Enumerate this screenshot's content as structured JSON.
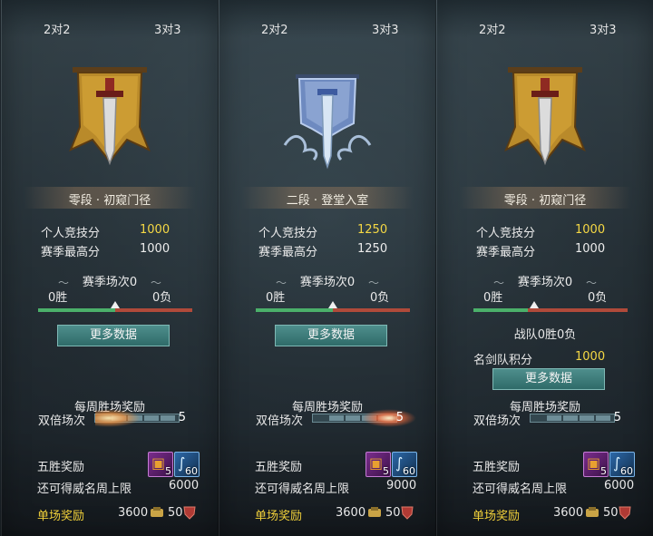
{
  "tabs": {
    "two": "2对2",
    "three": "3对3"
  },
  "panels": [
    {
      "rank": "零段 · 初窥门径",
      "score_label": "个人竞技分",
      "score": "1000",
      "best_label": "赛季最高分",
      "best": "1000",
      "season_label": "赛季场次0",
      "wins": "0胜",
      "losses": "0负",
      "more_btn": "更多数据",
      "weekly_label": "每周胜场奖励",
      "double_label": "双倍场次",
      "double_count": "5",
      "five_win_label": "五胜奖励",
      "item1_count": "5",
      "item2_count": "60",
      "cap_label": "还可得威名周上限",
      "cap_val": "6000",
      "single_label": "单场奖励",
      "single_coin": "3600",
      "single_shield": "50"
    },
    {
      "rank": "二段 · 登堂入室",
      "score_label": "个人竞技分",
      "score": "1250",
      "best_label": "赛季最高分",
      "best": "1250",
      "season_label": "赛季场次0",
      "wins": "0胜",
      "losses": "0负",
      "more_btn": "更多数据",
      "weekly_label": "每周胜场奖励",
      "double_label": "双倍场次",
      "double_count": "5",
      "five_win_label": "五胜奖励",
      "item1_count": "5",
      "item2_count": "60",
      "cap_label": "还可得威名周上限",
      "cap_val": "9000",
      "single_label": "单场奖励",
      "single_coin": "3600",
      "single_shield": "50"
    },
    {
      "rank": "零段 · 初窥门径",
      "score_label": "个人竞技分",
      "score": "1000",
      "best_label": "赛季最高分",
      "best": "1000",
      "season_label": "赛季场次0",
      "wins": "0胜",
      "losses": "0负",
      "team_label": "战队0胜0负",
      "team_pts_label": "名剑队积分",
      "team_pts": "1000",
      "more_btn": "更多数据",
      "weekly_label": "每周胜场奖励",
      "double_label": "双倍场次",
      "double_count": "5",
      "five_win_label": "五胜奖励",
      "item1_count": "5",
      "item2_count": "60",
      "cap_label": "还可得威名周上限",
      "cap_val": "6000",
      "single_label": "单场奖励",
      "single_coin": "3600",
      "single_shield": "50"
    }
  ],
  "colors": {
    "accent_gold": "#f5d844",
    "win_green": "#4bb06a",
    "loss_red": "#b04a3a",
    "button_teal": "#2f6b69"
  }
}
